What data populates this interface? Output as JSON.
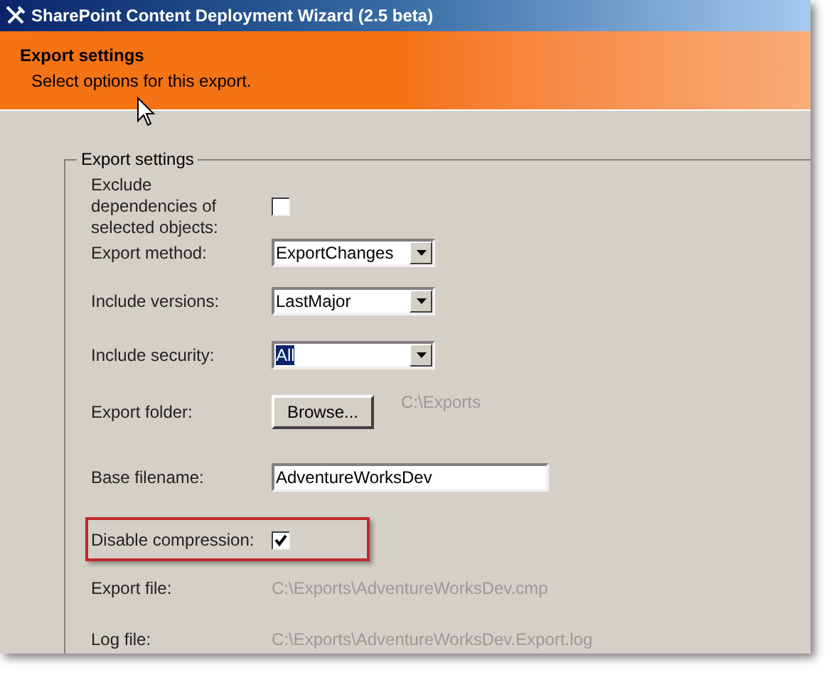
{
  "window": {
    "title": "SharePoint Content Deployment Wizard (2.5 beta)"
  },
  "header": {
    "title": "Export settings",
    "subtitle": "Select options for this export."
  },
  "group": {
    "title": "Export settings",
    "rows": [
      {
        "kind": "checkbox",
        "label": "Exclude dependencies of selected objects:",
        "checked": false
      },
      {
        "kind": "dropdown",
        "label": "Export method:",
        "value": "ExportChanges",
        "focused": false
      },
      {
        "kind": "dropdown",
        "label": "Include versions:",
        "value": "LastMajor",
        "focused": false
      },
      {
        "kind": "dropdown",
        "label": "Include security:",
        "value": "All",
        "focused": true
      },
      {
        "kind": "browse",
        "label": "Export folder:",
        "button": "Browse...",
        "path": "C:\\Exports"
      },
      {
        "kind": "textfield",
        "label": "Base filename:",
        "value": "AdventureWorksDev"
      },
      {
        "kind": "checkbox",
        "label": "Disable compression:",
        "checked": true,
        "highlighted": true
      },
      {
        "kind": "static",
        "label": "Export file:",
        "value": "C:\\Exports\\AdventureWorksDev.cmp"
      },
      {
        "kind": "static",
        "label": "Log file:",
        "value": "C:\\Exports\\AdventureWorksDev.Export.log"
      }
    ]
  }
}
